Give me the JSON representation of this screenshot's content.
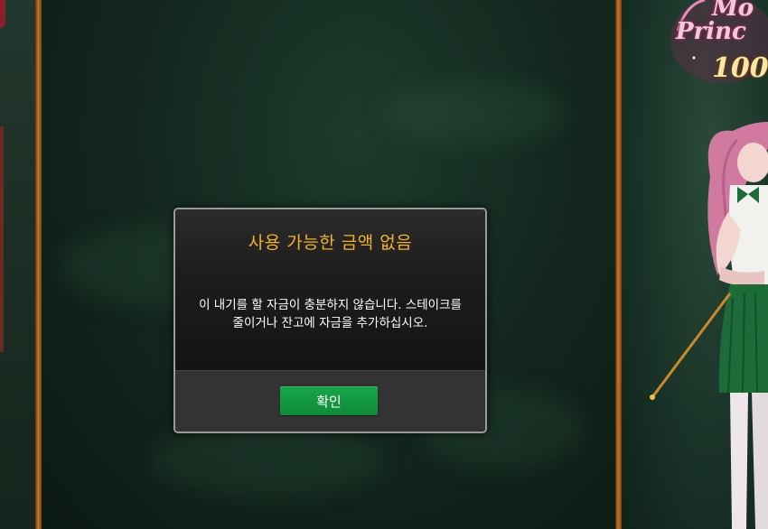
{
  "game": {
    "logo_line1": "Mo",
    "logo_line2": "Princ",
    "logo_line3": "100"
  },
  "dialog": {
    "title": "사용 가능한 금액 없음",
    "message_line1": "이 내기를 할 자금이 충분하지 않습니다. 스테이크를",
    "message_line2": "줄이거나 잔고에 자금을 추가하십시오.",
    "confirm_label": "확인"
  },
  "colors": {
    "title_accent": "#f0b22d",
    "confirm_button": "#12993f",
    "frame_gold": "#c47a2a"
  }
}
